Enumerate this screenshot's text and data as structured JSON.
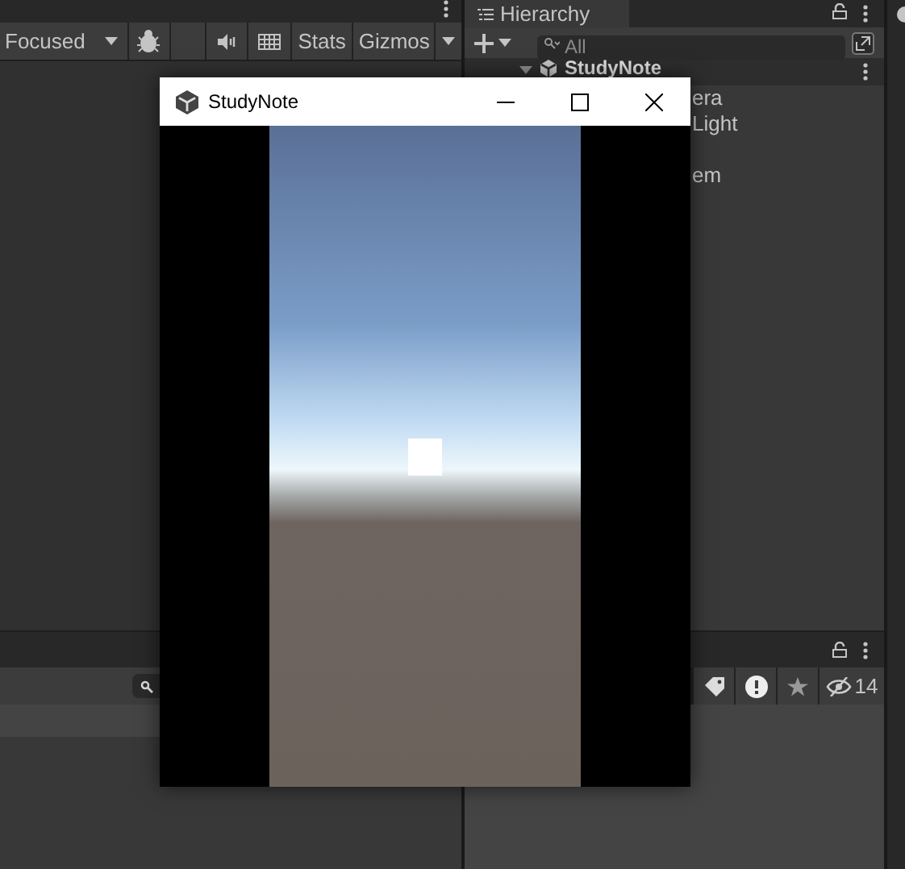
{
  "game_toolbar": {
    "focus_mode": "Focused",
    "stats": "Stats",
    "gizmos": "Gizmos"
  },
  "hierarchy": {
    "tab": "Hierarchy",
    "search": {
      "placeholder": "All"
    },
    "scene": "StudyNote",
    "items": [
      {
        "label": "era"
      },
      {
        "label": "Light"
      },
      {
        "label": "em"
      }
    ]
  },
  "console": {
    "hidden_count": "14"
  },
  "game_window": {
    "title": "StudyNote"
  }
}
